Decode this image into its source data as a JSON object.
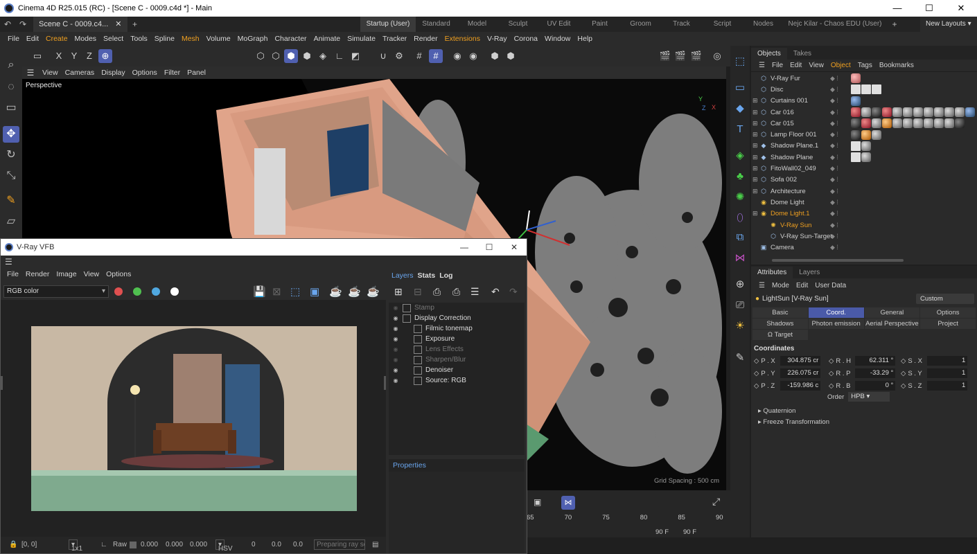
{
  "window": {
    "title": "Cinema 4D R25.015 (RC) - [Scene C - 0009.c4d *] - Main",
    "controls": [
      "—",
      "☐",
      "✕"
    ]
  },
  "doc_tab": {
    "label": "Scene C - 0009.c4...",
    "close": "✕",
    "add": "+"
  },
  "layout_tabs": [
    "Startup (User)",
    "Standard",
    "Model",
    "Sculpt",
    "UV Edit",
    "Paint",
    "Groom",
    "Track",
    "Script",
    "Nodes",
    "Nejc Kilar - Chaos EDU (User)"
  ],
  "new_layouts": "New Layouts",
  "add_layout": "+",
  "menu": [
    "File",
    "Edit",
    "Create",
    "Modes",
    "Select",
    "Tools",
    "Spline",
    "Mesh",
    "Volume",
    "MoGraph",
    "Character",
    "Animate",
    "Simulate",
    "Tracker",
    "Render",
    "Extensions",
    "V-Ray",
    "Corona",
    "Window",
    "Help"
  ],
  "toolbar": {
    "x": "X",
    "y": "Y",
    "z": "Z"
  },
  "viewport": {
    "menu": [
      "View",
      "Cameras",
      "Display",
      "Options",
      "Filter",
      "Panel"
    ],
    "label": "Perspective",
    "grid_spacing": "Grid Spacing : 500 cm"
  },
  "objects": {
    "tabs": [
      "Objects",
      "Takes"
    ],
    "menu": [
      "File",
      "Edit",
      "View",
      "Object",
      "Tags",
      "Bookmarks"
    ],
    "items": [
      {
        "name": "V-Ray Fur",
        "icon": "fur-icon"
      },
      {
        "name": "Disc",
        "icon": "disc-icon"
      },
      {
        "name": "Curtains 001",
        "icon": "null-icon"
      },
      {
        "name": "Car 016",
        "icon": "null-icon"
      },
      {
        "name": "Car 015",
        "icon": "null-icon"
      },
      {
        "name": "Lamp Floor 001",
        "icon": "null-icon"
      },
      {
        "name": "Shadow Plane.1",
        "icon": "plane-icon"
      },
      {
        "name": "Shadow Plane",
        "icon": "plane-icon"
      },
      {
        "name": "FitoWall02_049",
        "icon": "null-icon"
      },
      {
        "name": "Sofa 002",
        "icon": "null-icon"
      },
      {
        "name": "Architecture",
        "icon": "null-icon"
      },
      {
        "name": "Dome Light",
        "icon": "light-icon"
      },
      {
        "name": "Dome Light.1",
        "icon": "light-icon"
      },
      {
        "name": "V-Ray Sun",
        "icon": "sun-icon"
      },
      {
        "name": "V-Ray Sun-Target",
        "icon": "target-icon"
      },
      {
        "name": "Camera",
        "icon": "camera-icon"
      }
    ]
  },
  "attributes": {
    "tabs": [
      "Attributes",
      "Layers"
    ],
    "menu": [
      "Mode",
      "Edit",
      "User Data"
    ],
    "object_label": "LightSun [V-Ray Sun]",
    "preset": "Custom",
    "tabs_grid": [
      "Basic",
      "Coord.",
      "General",
      "Options",
      "Shadows",
      "Photon emission",
      "Aerial Perspective",
      "Project"
    ],
    "target": "Ω Target",
    "coord_title": "Coordinates",
    "coords": [
      {
        "p": "P . X",
        "pv": "304.875 cr",
        "r": "R . H",
        "rv": "62.311 °",
        "s": "S . X",
        "sv": "1"
      },
      {
        "p": "P . Y",
        "pv": "226.075 cr",
        "r": "R . P",
        "rv": "-33.29 °",
        "s": "S . Y",
        "sv": "1"
      },
      {
        "p": "P . Z",
        "pv": "-159.986 c",
        "r": "R . B",
        "rv": "0 °",
        "s": "S . Z",
        "sv": "1"
      }
    ],
    "order_label": "Order",
    "order_value": "HPB",
    "quaternion": "Quaternion",
    "freeze": "Freeze Transformation"
  },
  "timeline": {
    "ticks": [
      "65",
      "70",
      "75",
      "80",
      "85",
      "90"
    ],
    "frame_a": "90 F",
    "frame_b": "90 F"
  },
  "vfb": {
    "title": "V-Ray VFB",
    "controls": [
      "—",
      "☐",
      "✕"
    ],
    "menu": [
      "File",
      "Render",
      "Image",
      "View",
      "Options"
    ],
    "channel": "RGB color",
    "right_tabs": [
      "Layers",
      "Stats",
      "Log"
    ],
    "layers": [
      {
        "name": "Stamp",
        "on": false
      },
      {
        "name": "Display Correction",
        "on": true
      },
      {
        "name": "Filmic tonemap",
        "on": true
      },
      {
        "name": "Exposure",
        "on": true
      },
      {
        "name": "Lens Effects",
        "on": false
      },
      {
        "name": "Sharpen/Blur",
        "on": false
      },
      {
        "name": "Denoiser",
        "on": true
      },
      {
        "name": "Source: RGB",
        "on": true
      }
    ],
    "properties": "Properties",
    "status": {
      "coords": "[0, 0]",
      "zoom": "1x1",
      "raw": "Raw",
      "v1": "0.000",
      "v2": "0.000",
      "v3": "0.000",
      "mode": "HSV",
      "h": "0",
      "s": "0.0",
      "v": "0.0",
      "progress": "Preparing ray se"
    }
  }
}
